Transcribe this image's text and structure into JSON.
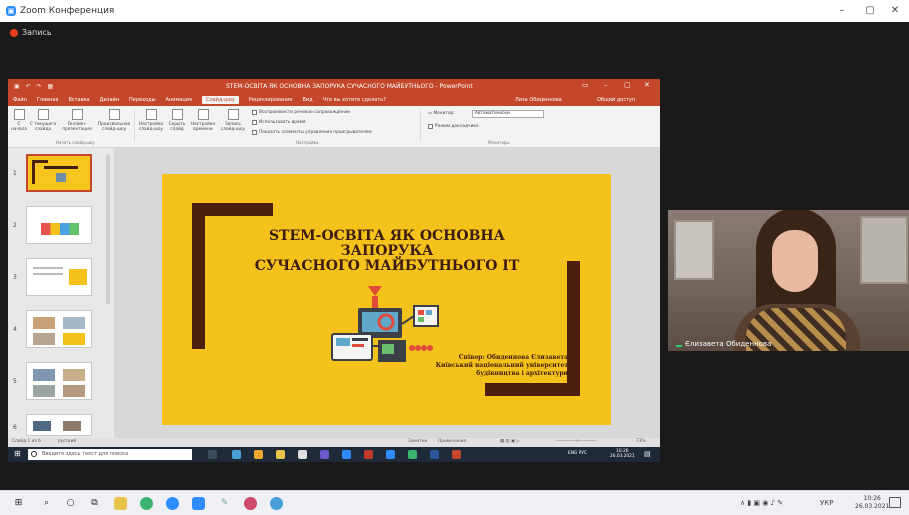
{
  "window": {
    "title": "Zoom Конференция",
    "minimize_glyph": "–",
    "restore_glyph": "▢",
    "close_glyph": "✕"
  },
  "recording": {
    "label": "Запись",
    "color": "#e8401c"
  },
  "powerpoint": {
    "doc_title": "STEM-ОСВІТА ЯК ОСНОВНА ЗАПОРУКА СУЧАСНОГО МАЙБУТНЬОГО - PowerPoint",
    "tabs": [
      "Файл",
      "Главная",
      "Вставка",
      "Дизайн",
      "Переходы",
      "Анимация",
      "Слайд-шоу",
      "Рецензирование",
      "Вид",
      "Что вы хотите сделать?"
    ],
    "active_tab": "Слайд-шоу",
    "user": "Лиза Обиденнова",
    "share_label": "Общий доступ",
    "ribbon": {
      "btn_from_start": "С начала",
      "btn_from_current": "С текущего слайда",
      "btn_online": "Онлайн-презентация",
      "btn_custom": "Произвольное слайд-шоу",
      "btn_setup": "Настройка слайд-шоу",
      "btn_hide": "Скрыть слайд",
      "btn_rehearse": "Настройка времени",
      "btn_record": "Запись слайд-шоу",
      "group_start": "Начать слайд-шоу",
      "chk_narration": "Воспроизвести речевое сопровождение",
      "chk_timings": "Использовать время",
      "chk_controls": "Показать элементы управления проигрывателем",
      "group_setup": "Настройка",
      "monitor_label": "Монитор:",
      "monitor_value": "Автоматически",
      "presenter_view": "Режим докладчика",
      "group_monitors": "Мониторы"
    },
    "thumb_numbers": [
      "1",
      "2",
      "3",
      "4",
      "5",
      "6"
    ],
    "slide": {
      "title_line1": "STEM-ОСВІТА ЯК ОСНОВНА ЗАПОРУКА",
      "title_line2": "СУЧАСНОГО МАЙБУТНЬОГО IT",
      "author_line1": "Співор: Обиденнова Єлизавета",
      "author_line2": "Київський національний університет",
      "author_line3": "будівництва і архітектури",
      "background": "#f4c21b",
      "bracket_color": "#4a1f0e"
    },
    "status": {
      "slide_of": "Слайд 1 из 6",
      "language": "русский",
      "notes": "Заметки",
      "comments": "Примечания",
      "zoom": "73%"
    }
  },
  "inner_taskbar": {
    "search_placeholder": "Введите здесь текст для поиска",
    "lang": "ENG  РУС",
    "time": "10:26",
    "date": "26.03.2021"
  },
  "participant": {
    "name": "Єлизавета Обиденнова"
  },
  "taskbar": {
    "lang": "УКР",
    "time": "10:26",
    "date": "26.03.2021"
  }
}
